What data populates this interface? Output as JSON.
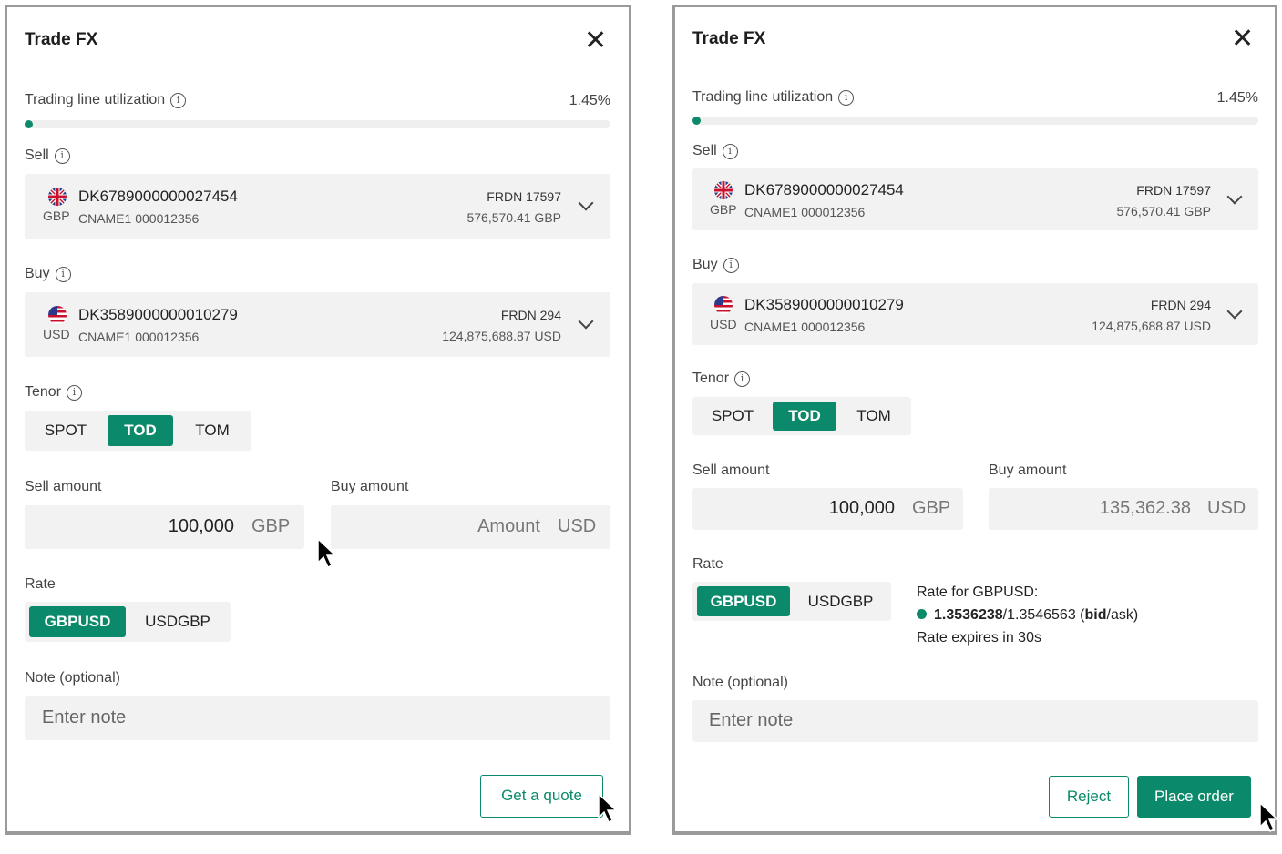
{
  "left": {
    "title": "Trade FX",
    "close_symbol": "✕",
    "trading_line": {
      "label": "Trading line utilization",
      "percent_text": "1.45%",
      "fraction": 0.0145
    },
    "sell": {
      "label": "Sell",
      "iban": "DK6789000000027454",
      "currency": "GBP",
      "cname": "CNAME1 000012356",
      "frdn": "FRDN 17597",
      "balance": "576,570.41 GBP"
    },
    "buy": {
      "label": "Buy",
      "iban": "DK3589000000010279",
      "currency": "USD",
      "cname": "CNAME1 000012356",
      "frdn": "FRDN 294",
      "balance": "124,875,688.87 USD"
    },
    "tenor": {
      "label": "Tenor",
      "options": [
        "SPOT",
        "TOD",
        "TOM"
      ],
      "selected": "TOD"
    },
    "sell_amount": {
      "label": "Sell amount",
      "value": "100,000",
      "currency": "GBP"
    },
    "buy_amount": {
      "label": "Buy amount",
      "placeholder": "Amount",
      "currency": "USD"
    },
    "rate": {
      "label": "Rate",
      "options": [
        "GBPUSD",
        "USDGBP"
      ],
      "selected": "GBPUSD"
    },
    "note": {
      "label": "Note (optional)",
      "placeholder": "Enter note"
    },
    "actions": {
      "quote_label": "Get a quote"
    }
  },
  "right": {
    "title": "Trade FX",
    "close_symbol": "✕",
    "trading_line": {
      "label": "Trading line utilization",
      "percent_text": "1.45%",
      "fraction": 0.0145
    },
    "sell": {
      "label": "Sell",
      "iban": "DK6789000000027454",
      "currency": "GBP",
      "cname": "CNAME1 000012356",
      "frdn": "FRDN 17597",
      "balance": "576,570.41 GBP"
    },
    "buy": {
      "label": "Buy",
      "iban": "DK3589000000010279",
      "currency": "USD",
      "cname": "CNAME1 000012356",
      "frdn": "FRDN 294",
      "balance": "124,875,688.87 USD"
    },
    "tenor": {
      "label": "Tenor",
      "options": [
        "SPOT",
        "TOD",
        "TOM"
      ],
      "selected": "TOD"
    },
    "sell_amount": {
      "label": "Sell amount",
      "value": "100,000",
      "currency": "GBP"
    },
    "buy_amount": {
      "label": "Buy amount",
      "value": "135,362.38",
      "currency": "USD"
    },
    "rate": {
      "label": "Rate",
      "options": [
        "GBPUSD",
        "USDGBP"
      ],
      "selected": "GBPUSD",
      "info_title": "Rate for GBPUSD:",
      "bid": "1.3536238",
      "separator": "/",
      "ask": "1.3546563",
      "bid_word": "bid",
      "ask_suffix": "/ask)",
      "open_paren": " (",
      "expiry": "Rate expires in 30s"
    },
    "note": {
      "label": "Note (optional)",
      "placeholder": "Enter note"
    },
    "actions": {
      "reject_label": "Reject",
      "place_label": "Place order"
    }
  },
  "colors": {
    "accent": "#0a8a6a",
    "field_bg": "#f2f2f2",
    "border": "#9a9a9a"
  },
  "icons": {
    "info": "info-icon",
    "close": "close-icon",
    "chevron": "chevron-down-icon",
    "uk_flag": "uk-flag-icon",
    "us_flag": "us-flag-icon",
    "cursor": "mouse-cursor-icon"
  }
}
